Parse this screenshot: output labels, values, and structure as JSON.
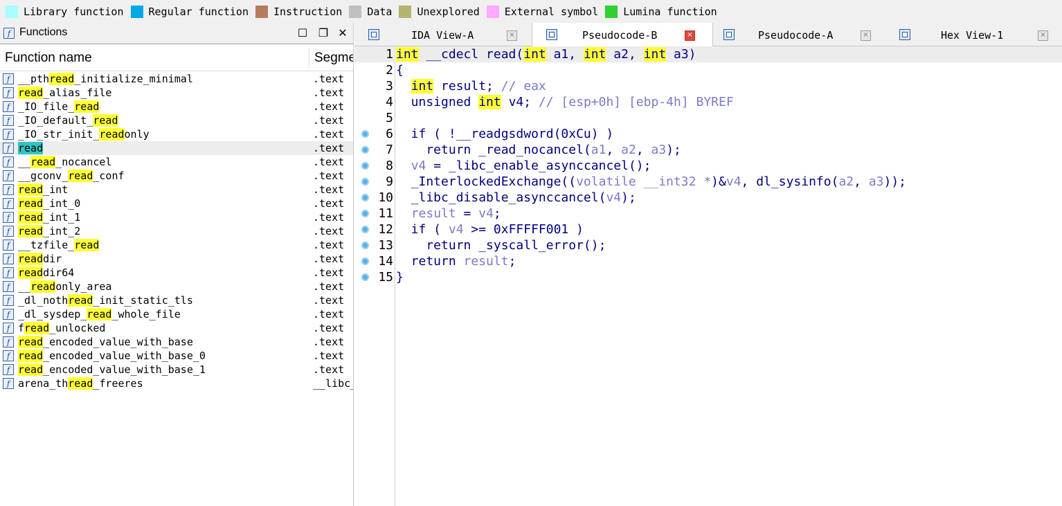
{
  "legend": [
    {
      "label": "Library function",
      "color": "#a8ffff"
    },
    {
      "label": "Regular function",
      "color": "#00a8e8"
    },
    {
      "label": "Instruction",
      "color": "#b87c5c"
    },
    {
      "label": "Data",
      "color": "#c0c0c0"
    },
    {
      "label": "Unexplored",
      "color": "#b4b46c"
    },
    {
      "label": "External symbol",
      "color": "#ffa8ff"
    },
    {
      "label": "Lumina function",
      "color": "#30d030"
    }
  ],
  "functions_panel": {
    "title": "Functions",
    "columns": {
      "name": "Function name",
      "segment": "Segme"
    },
    "rows": [
      {
        "parts": [
          "__pth",
          "read",
          "_initialize_minimal"
        ],
        "segment": ".text"
      },
      {
        "parts": [
          "",
          "read",
          "_alias_file"
        ],
        "segment": ".text"
      },
      {
        "parts": [
          "_IO_file_",
          "read",
          ""
        ],
        "segment": ".text"
      },
      {
        "parts": [
          "_IO_default_",
          "read",
          ""
        ],
        "segment": ".text"
      },
      {
        "parts": [
          "_IO_str_init_",
          "read",
          "only"
        ],
        "segment": ".text"
      },
      {
        "parts": [
          "",
          "read",
          ""
        ],
        "segment": ".text",
        "selected": true
      },
      {
        "parts": [
          "__",
          "read",
          "_nocancel"
        ],
        "segment": ".text"
      },
      {
        "parts": [
          "__gconv_",
          "read",
          "_conf"
        ],
        "segment": ".text"
      },
      {
        "parts": [
          "",
          "read",
          "_int"
        ],
        "segment": ".text"
      },
      {
        "parts": [
          "",
          "read",
          "_int_0"
        ],
        "segment": ".text"
      },
      {
        "parts": [
          "",
          "read",
          "_int_1"
        ],
        "segment": ".text"
      },
      {
        "parts": [
          "",
          "read",
          "_int_2"
        ],
        "segment": ".text"
      },
      {
        "parts": [
          "__tzfile_",
          "read",
          ""
        ],
        "segment": ".text"
      },
      {
        "parts": [
          "",
          "read",
          "dir"
        ],
        "segment": ".text"
      },
      {
        "parts": [
          "",
          "read",
          "dir64"
        ],
        "segment": ".text"
      },
      {
        "parts": [
          "__",
          "read",
          "only_area"
        ],
        "segment": ".text"
      },
      {
        "parts": [
          "_dl_noth",
          "read",
          "_init_static_tls"
        ],
        "segment": ".text"
      },
      {
        "parts": [
          "_dl_sysdep_",
          "read",
          "_whole_file"
        ],
        "segment": ".text"
      },
      {
        "parts": [
          "f",
          "read",
          "_unlocked"
        ],
        "segment": ".text"
      },
      {
        "parts": [
          "",
          "read",
          "_encoded_value_with_base"
        ],
        "segment": ".text"
      },
      {
        "parts": [
          "",
          "read",
          "_encoded_value_with_base_0"
        ],
        "segment": ".text"
      },
      {
        "parts": [
          "",
          "read",
          "_encoded_value_with_base_1"
        ],
        "segment": ".text"
      },
      {
        "parts": [
          "arena_th",
          "read",
          "_freeres"
        ],
        "segment": "__libc_"
      }
    ]
  },
  "tabs": [
    {
      "label": "IDA View-A",
      "active": false
    },
    {
      "label": "Pseudocode-B",
      "active": true
    },
    {
      "label": "Pseudocode-A",
      "active": false
    },
    {
      "label": "Hex View-1",
      "active": false
    }
  ],
  "code": {
    "line_numbers": [
      "1",
      "2",
      "3",
      "4",
      "5",
      "6",
      "7",
      "8",
      "9",
      "10",
      "11",
      "12",
      "13",
      "14",
      "15"
    ],
    "lines": [
      [
        [
          "hkw",
          "int"
        ],
        [
          "kw",
          " __cdecl read("
        ],
        [
          "hkw",
          "int"
        ],
        [
          "kw",
          " a1, "
        ],
        [
          "hkw",
          "int"
        ],
        [
          "kw",
          " a2, "
        ],
        [
          "hkw",
          "int"
        ],
        [
          "kw",
          " a3)"
        ]
      ],
      [
        [
          "kw",
          "{"
        ]
      ],
      [
        [
          "kw",
          "  "
        ],
        [
          "hkw",
          "int"
        ],
        [
          "kw",
          " result; "
        ],
        [
          "cm",
          "// eax"
        ]
      ],
      [
        [
          "kw",
          "  unsigned "
        ],
        [
          "hkw",
          "int"
        ],
        [
          "kw",
          " v4; "
        ],
        [
          "cm",
          "// [esp+0h] [ebp-4h] BYREF"
        ]
      ],
      [],
      [
        [
          "kw",
          "  if ( !__readgsdword(0xCu) )"
        ]
      ],
      [
        [
          "kw",
          "    return _read_nocancel("
        ],
        [
          "var",
          "a1"
        ],
        [
          "kw",
          ", "
        ],
        [
          "var",
          "a2"
        ],
        [
          "kw",
          ", "
        ],
        [
          "var",
          "a3"
        ],
        [
          "kw",
          ");"
        ]
      ],
      [
        [
          "kw",
          "  "
        ],
        [
          "var",
          "v4"
        ],
        [
          "kw",
          " = _libc_enable_asynccancel();"
        ]
      ],
      [
        [
          "kw",
          "  _InterlockedExchange(("
        ],
        [
          "var",
          "volatile __int32 *"
        ],
        [
          "kw",
          ")&"
        ],
        [
          "var",
          "v4"
        ],
        [
          "kw",
          ", dl_sysinfo("
        ],
        [
          "var",
          "a2"
        ],
        [
          "kw",
          ", "
        ],
        [
          "var",
          "a3"
        ],
        [
          "kw",
          "));"
        ]
      ],
      [
        [
          "kw",
          "  _libc_disable_asynccancel("
        ],
        [
          "var",
          "v4"
        ],
        [
          "kw",
          ");"
        ]
      ],
      [
        [
          "kw",
          "  "
        ],
        [
          "var",
          "result"
        ],
        [
          "kw",
          " = "
        ],
        [
          "var",
          "v4"
        ],
        [
          "kw",
          ";"
        ]
      ],
      [
        [
          "kw",
          "  if ( "
        ],
        [
          "var",
          "v4"
        ],
        [
          "kw",
          " >= 0xFFFFF001 )"
        ]
      ],
      [
        [
          "kw",
          "    return _syscall_error();"
        ]
      ],
      [
        [
          "kw",
          "  return "
        ],
        [
          "var",
          "result"
        ],
        [
          "kw",
          ";"
        ]
      ],
      [
        [
          "kw",
          "}"
        ]
      ]
    ],
    "breakpoint_lines": [
      6,
      7,
      8,
      9,
      10,
      11,
      12,
      13,
      14,
      15
    ]
  }
}
